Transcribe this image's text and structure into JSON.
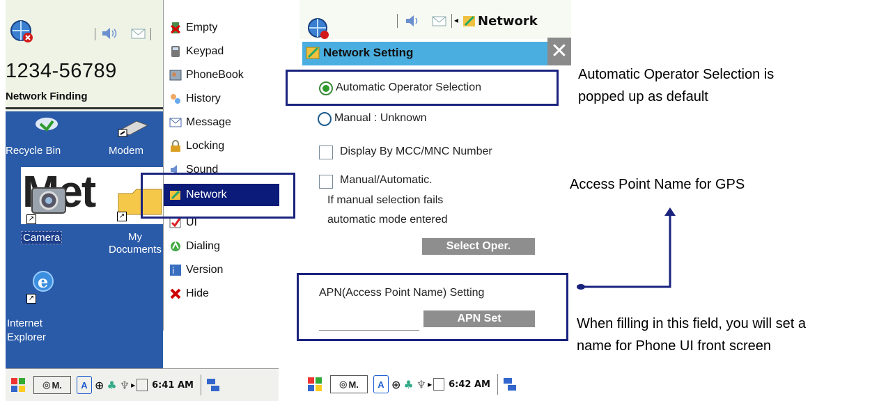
{
  "left_screen": {
    "phone_number": "1234-56789",
    "network_status": "Network Finding",
    "desktop": {
      "recycle_bin": "Recycle Bin",
      "modem": "Modem",
      "camera": "Camera",
      "my_documents_line1": "My",
      "my_documents_line2": "Documents",
      "internet_explorer_line1": "Internet",
      "internet_explorer_line2": "Explorer",
      "banner": "Met"
    },
    "start_menu": [
      {
        "label": "Empty",
        "icon": "empty-icon"
      },
      {
        "label": "Keypad",
        "icon": "keypad-icon"
      },
      {
        "label": "PhoneBook",
        "icon": "phonebook-icon"
      },
      {
        "label": "History",
        "icon": "history-icon"
      },
      {
        "label": "Message",
        "icon": "message-icon"
      },
      {
        "label": "Locking",
        "icon": "lock-icon"
      },
      {
        "label": "Sound",
        "icon": "sound-icon"
      },
      {
        "label": "Network",
        "icon": "network-icon"
      },
      {
        "label": "UI",
        "icon": "ui-icon"
      },
      {
        "label": "Dialing",
        "icon": "dialing-icon"
      },
      {
        "label": "Version",
        "icon": "version-icon"
      },
      {
        "label": "Hide",
        "icon": "hide-icon"
      }
    ],
    "highlighted_item": "Network",
    "taskbar": {
      "app_button": "M.",
      "time": "6:41 AM",
      "input_indicator": "A"
    }
  },
  "right_screen": {
    "top_bar_title": "Network",
    "window_title": "Network Setting",
    "close_glyph": "✕",
    "options": {
      "auto_operator": "Automatic Operator Selection",
      "manual": "Manual : Unknown",
      "display_mcc": "Display By MCC/MNC Number",
      "manual_auto": "Manual/Automatic.",
      "manual_auto_note1": "If manual selection fails",
      "manual_auto_note2": "automatic mode entered"
    },
    "select_oper_button": "Select Oper.",
    "apn_label": "APN(Access Point Name) Setting",
    "apn_input_value": "",
    "apn_set_button": "APN Set",
    "taskbar": {
      "app_button": "M.",
      "time": "6:42 AM",
      "input_indicator": "A"
    }
  },
  "annotations": {
    "auto_default_line1": "Automatic Operator Selection is",
    "auto_default_line2": "popped up as  default",
    "apn_gps": "Access Point Name for GPS",
    "apn_field_line1": "When filling in this field, you will set a",
    "apn_field_line2": "name for Phone UI front screen"
  },
  "colors": {
    "desktop_blue": "#2a5ba8",
    "menu_highlight": "#0b1b79",
    "title_bar": "#4aaee0",
    "callout_border": "#1a237e",
    "radio_selected": "#2e8b2e"
  }
}
